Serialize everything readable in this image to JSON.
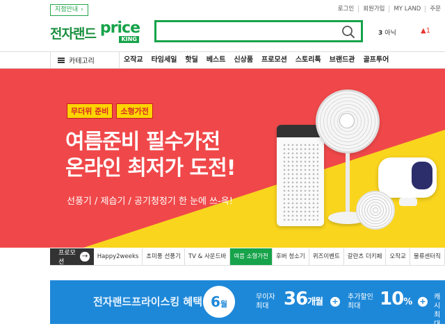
{
  "header": {
    "store_locator": "지점안내",
    "top_links": [
      "로그인",
      "회원가입",
      "MY LAND",
      "주문"
    ],
    "logo_text": "전자랜드",
    "logo_price": "price",
    "logo_king": "KING",
    "search_placeholder": "",
    "recent_count": "3",
    "recent_label": "아닉",
    "alert_label": "1"
  },
  "nav": {
    "category_label": "카테고리",
    "items": [
      "오작교",
      "타임세일",
      "핫딜",
      "베스트",
      "신상품",
      "프로모션",
      "스토리톡",
      "브랜드관",
      "골프투어"
    ]
  },
  "hero": {
    "tags": [
      "무더위 준비",
      "소형가전"
    ],
    "headline_line1": "여름준비 필수가전",
    "headline_line2": "온라인 최저가 도전!",
    "subtext": "선풍기 / 제습기 / 공기청정기 한 눈에 쓰-윽!"
  },
  "promo": {
    "label": "프로모션",
    "tabs": [
      "Happy2weeks",
      "초미풍 선풍기",
      "TV & 사운드바",
      "여름 소형가전",
      "후버 청소기",
      "퀴즈이벤트",
      "갈란츠 더키페",
      "오작교",
      "물류센터직"
    ],
    "active_index": 3
  },
  "benefit": {
    "title": "전자랜드프라이스킹 혜택",
    "month": "6",
    "month_unit": "월",
    "item1_line1": "무이자",
    "item1_line2": "최대",
    "item1_value": "36",
    "item1_unit": "개월",
    "item2_line1": "추가할인",
    "item2_line2": "최대",
    "item2_value": "10",
    "item2_unit": "%",
    "item3_line1": "캐시",
    "item3_line2": "최대"
  },
  "colors": {
    "brand_green": "#16a34a",
    "hero_red": "#f0484a",
    "hero_yellow": "#f9d51e",
    "benefit_blue": "#1e88d8"
  }
}
